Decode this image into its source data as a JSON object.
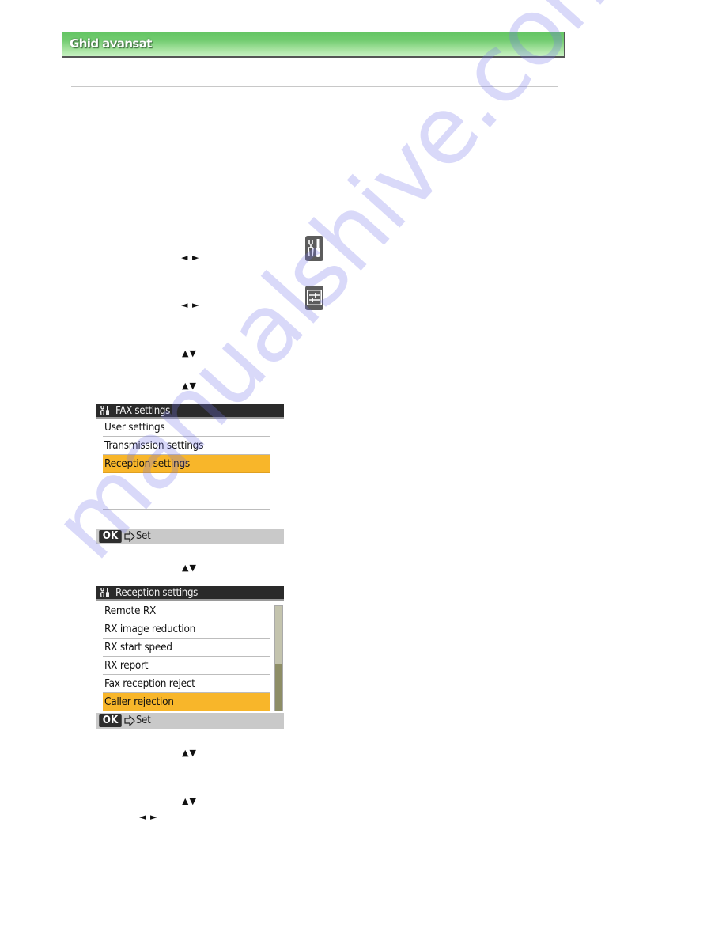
{
  "header": {
    "title": "Ghid avansat"
  },
  "steps": {
    "nav_left_right_1": "◄ ►",
    "nav_left_right_2": "◄ ►",
    "nav_up_down_1": "▲▼",
    "nav_up_down_2": "▲▼",
    "nav_up_down_3": "▲▼",
    "nav_up_down_4": "▲▼",
    "nav_up_down_5": "▲▼",
    "nav_left_right_3": "◄ ►"
  },
  "icons": {
    "setup_icon": "tools-icon",
    "settings_icon": "sliders-icon"
  },
  "lcd_fax_settings": {
    "title": "FAX settings",
    "title_icon": "tools-icon",
    "items": [
      {
        "label": "User settings",
        "selected": false
      },
      {
        "label": "Transmission settings",
        "selected": false
      },
      {
        "label": "Reception settings",
        "selected": true
      },
      {
        "label": "",
        "selected": false
      },
      {
        "label": "",
        "selected": false
      }
    ],
    "footer": {
      "ok_label": "OK",
      "action_label": "Set"
    }
  },
  "lcd_reception_settings": {
    "title": "Reception settings",
    "title_icon": "tools-icon",
    "items": [
      {
        "label": "Remote RX",
        "selected": false
      },
      {
        "label": "RX image reduction",
        "selected": false
      },
      {
        "label": "RX start speed",
        "selected": false
      },
      {
        "label": "RX report",
        "selected": false
      },
      {
        "label": "Fax reception reject",
        "selected": false
      },
      {
        "label": "Caller rejection",
        "selected": true
      }
    ],
    "scrollbar": {
      "position_fraction": 0.55,
      "visible_fraction": 0.45
    },
    "footer": {
      "ok_label": "OK",
      "action_label": "Set"
    }
  },
  "watermark": {
    "text": "manualshive.com"
  },
  "colors": {
    "header_green": "#72cc70",
    "highlight_orange": "#f8b62a",
    "lcd_title_bg": "#2a2a2a",
    "lcd_footer_bg": "#c9c9c9"
  }
}
